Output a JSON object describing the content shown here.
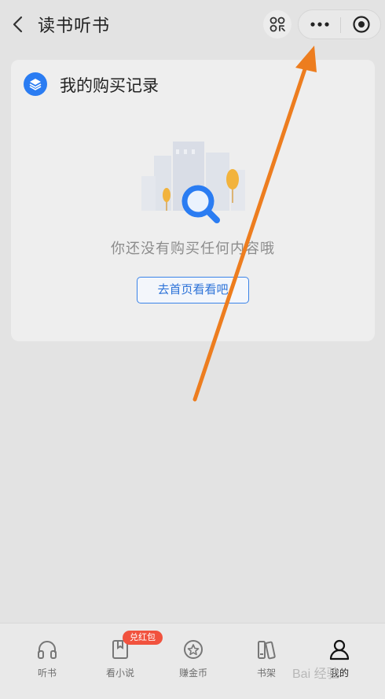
{
  "header": {
    "title": "读书听书",
    "back_icon": "chevron-left-icon",
    "scan_icon": "scan-icon",
    "more_icon": "more-dots-icon",
    "close_icon": "close-circle-icon"
  },
  "card": {
    "title": "我的购买记录",
    "icon": "layers-icon",
    "empty_text": "你还没有购买任何内容哦",
    "home_button": "去首页看看吧"
  },
  "annotation": {
    "arrow_color": "#ed7d1f"
  },
  "tabbar": {
    "badge": "兑红包",
    "items": [
      {
        "label": "听书",
        "icon": "headphones-icon"
      },
      {
        "label": "看小说",
        "icon": "book-icon"
      },
      {
        "label": "赚金币",
        "icon": "coin-icon"
      },
      {
        "label": "书架",
        "icon": "bookshelf-icon"
      },
      {
        "label": "我的",
        "icon": "user-icon"
      }
    ]
  },
  "colors": {
    "accent": "#2a7cf2",
    "badge": "#f1523e",
    "background": "#e3e3e3"
  }
}
